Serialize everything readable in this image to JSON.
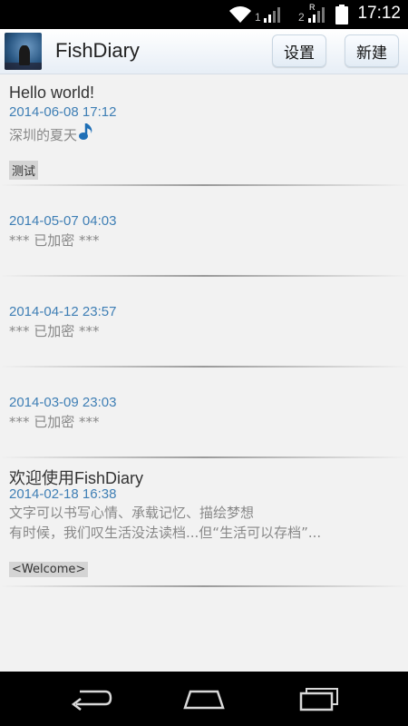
{
  "status_bar": {
    "time": "17:12",
    "sim1_label": "1",
    "sim2_label": "2",
    "roaming_label": "R"
  },
  "header": {
    "title": "FishDiary",
    "settings_label": "设置",
    "new_label": "新建"
  },
  "entries": [
    {
      "title": "Hello world!",
      "date": "2014-06-08 17:12",
      "body_lines": [
        "深圳的夏天"
      ],
      "has_music_icon": true,
      "tag": "测试"
    },
    {
      "title": "",
      "date": "2014-05-07 04:03",
      "body_lines": [
        "*** 已加密 ***"
      ],
      "tag": ""
    },
    {
      "title": "",
      "date": "2014-04-12 23:57",
      "body_lines": [
        "*** 已加密 ***"
      ],
      "tag": ""
    },
    {
      "title": "",
      "date": "2014-03-09 23:03",
      "body_lines": [
        "*** 已加密 ***"
      ],
      "tag": ""
    },
    {
      "title": "欢迎使用FishDiary",
      "date": "2014-02-18 16:38",
      "body_lines": [
        "文字可以书写心情、承载记忆、描绘梦想",
        "有时候，我们叹生活没法读档...但“生活可以存档”..."
      ],
      "tag": "<Welcome>"
    }
  ],
  "colors": {
    "date": "#3f7fb5",
    "tag_bg": "#d4d4d4",
    "music_note": "#1f6fb6"
  },
  "navigation": {
    "back": "back-icon",
    "home": "home-icon",
    "recents": "recents-icon"
  }
}
